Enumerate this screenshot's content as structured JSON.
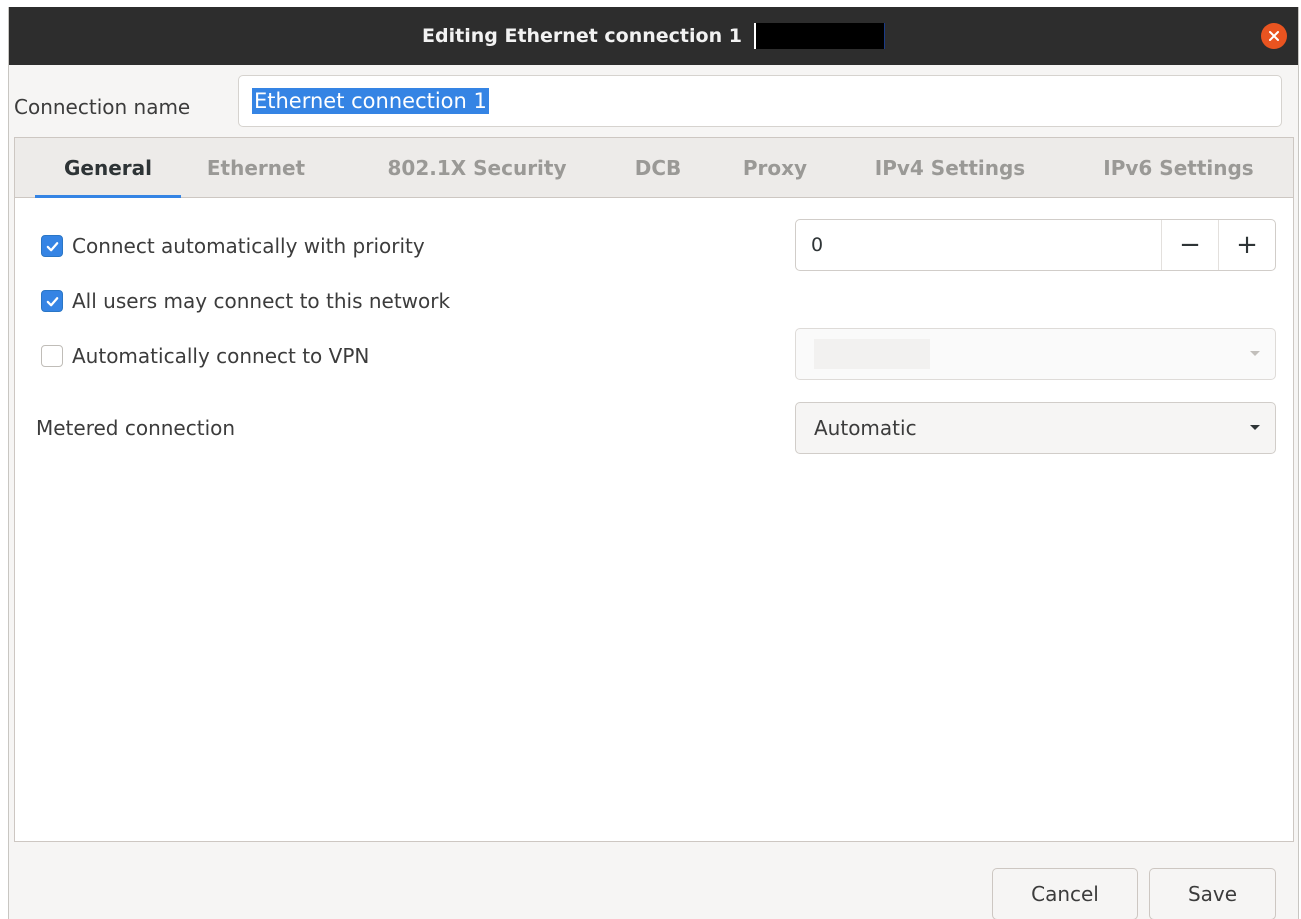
{
  "window": {
    "title": "Editing Ethernet connection 1",
    "close_icon": "close-icon",
    "accent": "#3584e4",
    "close_color": "#e95420"
  },
  "connection": {
    "label": "Connection name",
    "value": "Ethernet connection 1"
  },
  "tabs": [
    {
      "label": "General",
      "active": true
    },
    {
      "label": "Ethernet",
      "active": false
    },
    {
      "label": "802.1X Security",
      "active": false
    },
    {
      "label": "DCB",
      "active": false
    },
    {
      "label": "Proxy",
      "active": false
    },
    {
      "label": "IPv4 Settings",
      "active": false
    },
    {
      "label": "IPv6 Settings",
      "active": false
    }
  ],
  "general": {
    "auto_connect": {
      "label": "Connect automatically with priority",
      "checked": true
    },
    "priority": {
      "value": "0",
      "minus": "−",
      "plus": "+"
    },
    "all_users": {
      "label": "All users may connect to this network",
      "checked": true
    },
    "auto_vpn": {
      "label": "Automatically connect to VPN",
      "checked": false
    },
    "metered": {
      "label": "Metered connection",
      "value": "Automatic"
    }
  },
  "buttons": {
    "cancel": "Cancel",
    "save": "Save"
  }
}
